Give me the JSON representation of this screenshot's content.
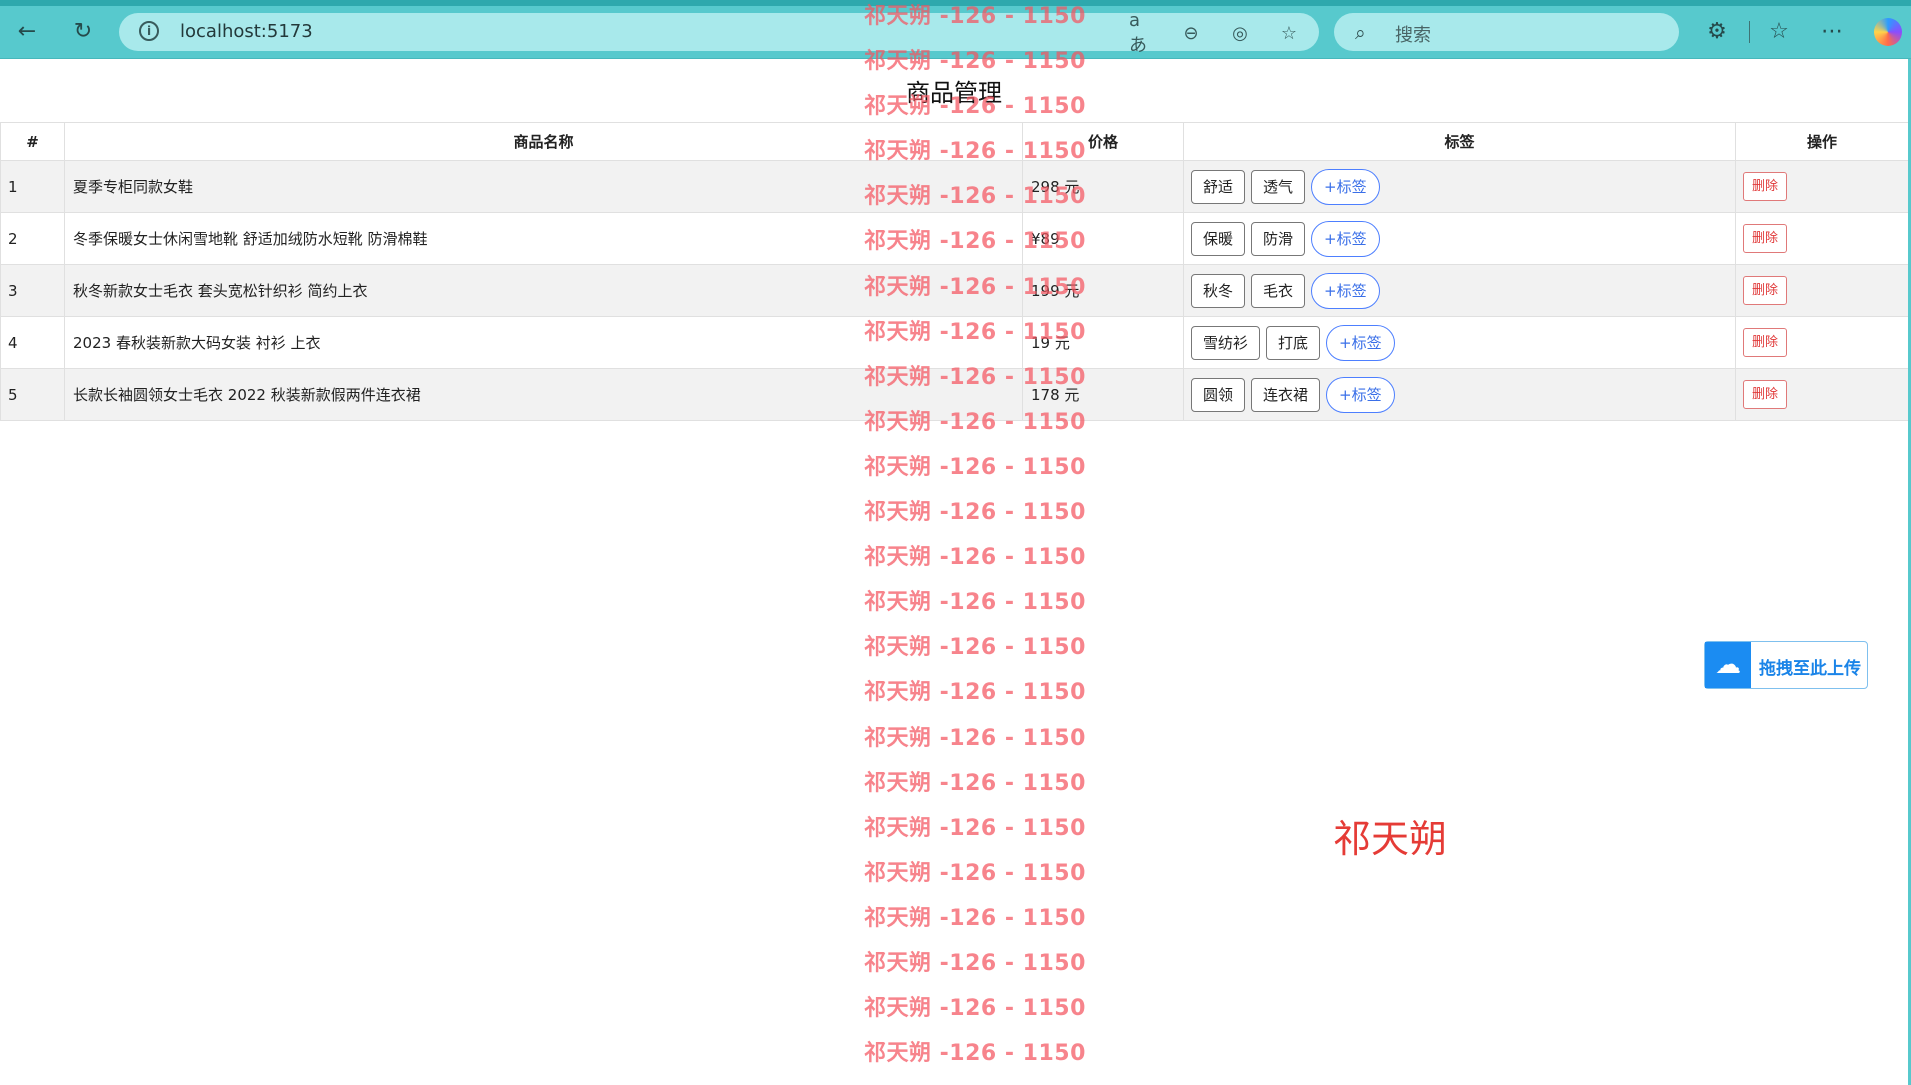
{
  "browser": {
    "url": "localhost:5173",
    "search_placeholder": "搜索"
  },
  "page": {
    "title": "商品管理",
    "headers": [
      "#",
      "商品名称",
      "价格",
      "标签",
      "操作"
    ],
    "products": [
      {
        "index": "1",
        "name": "夏季专柜同款女鞋",
        "price": "298 元",
        "tags": [
          "舒适",
          "透气"
        ],
        "add_tag": "+标签",
        "delete": "删除"
      },
      {
        "index": "2",
        "name": "冬季保暖女士休闲雪地靴 舒适加绒防水短靴 防滑棉鞋",
        "price": "¥89",
        "tags": [
          "保暖",
          "防滑"
        ],
        "add_tag": "+标签",
        "delete": "删除"
      },
      {
        "index": "3",
        "name": "秋冬新款女士毛衣 套头宽松针织衫 简约上衣",
        "price": "199 元",
        "tags": [
          "秋冬",
          "毛衣"
        ],
        "add_tag": "+标签",
        "delete": "删除"
      },
      {
        "index": "4",
        "name": "2023 春秋装新款大码女装 衬衫 上衣",
        "price": "19 元",
        "tags": [
          "雪纺衫",
          "打底"
        ],
        "add_tag": "+标签",
        "delete": "删除"
      },
      {
        "index": "5",
        "name": "长款长袖圆领女士毛衣 2022 秋装新款假两件连衣裙",
        "price": "178 元",
        "tags": [
          "圆领",
          "连衣裙"
        ],
        "add_tag": "+标签",
        "delete": "删除"
      }
    ]
  },
  "watermark": {
    "text": "祁天朔 -126 - 1150",
    "repeat_count": 24
  },
  "overlay": {
    "upload_label": "拖拽至此上传",
    "name": "祁天朔"
  }
}
